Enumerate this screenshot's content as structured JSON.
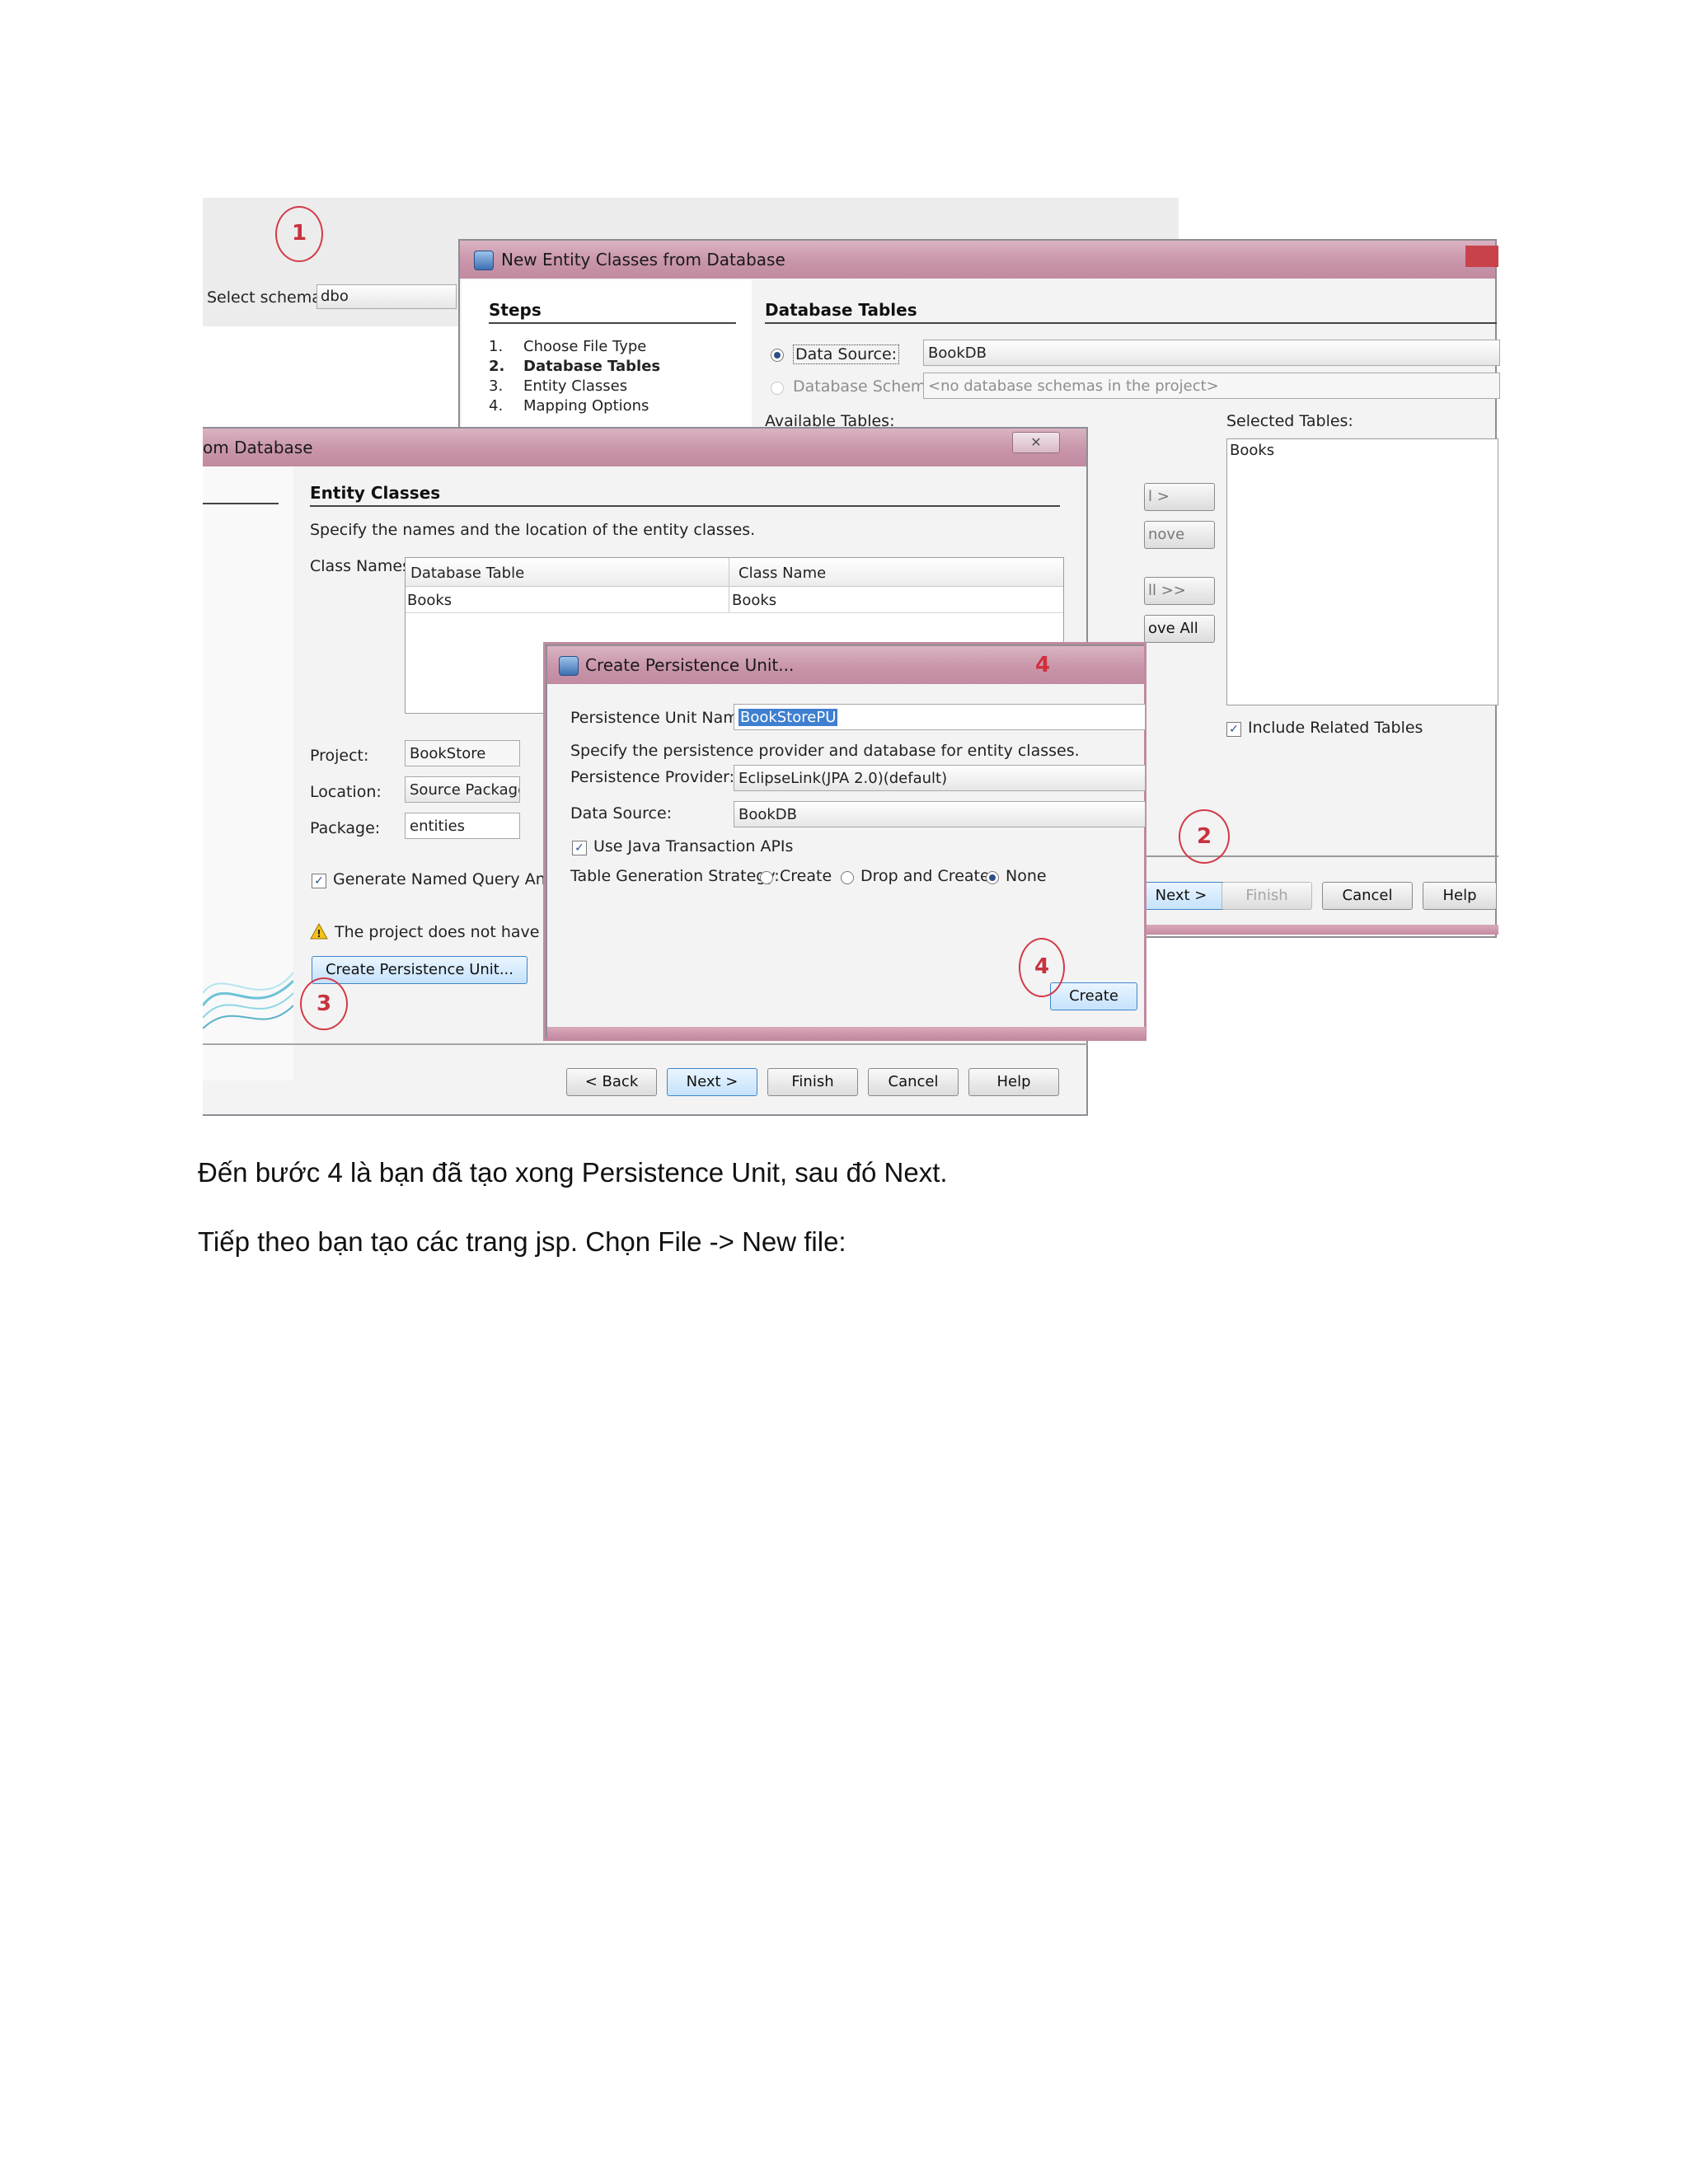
{
  "schema": {
    "label": "Select schema:",
    "value": "dbo"
  },
  "dialog1": {
    "title": "New Entity Classes from Database",
    "steps_heading": "Steps",
    "steps": [
      {
        "num": "1.",
        "label": "Choose File Type"
      },
      {
        "num": "2.",
        "label": "Database Tables"
      },
      {
        "num": "3.",
        "label": "Entity Classes"
      },
      {
        "num": "4.",
        "label": "Mapping Options"
      }
    ],
    "section": "Database Tables",
    "data_source_label": "Data Source:",
    "data_source_value": "BookDB",
    "schema_label": "Database Schema",
    "schema_value": "<no database schemas in the project>",
    "available_label": "Available Tables:",
    "selected_label": "Selected Tables:",
    "selected_items": [
      "Books"
    ],
    "partial_buttons": [
      "l >",
      "nove",
      "ll >>",
      "ove All"
    ],
    "include_related": "Include Related Tables",
    "buttons": {
      "next": "Next >",
      "finish": "Finish",
      "cancel": "Cancel",
      "help": "Help"
    }
  },
  "dialog2": {
    "title": "om Database",
    "close": "✕",
    "section": "Entity Classes",
    "description": "Specify the names and the location of the entity classes.",
    "class_names_label": "Class Names:",
    "columns": [
      "Database Table",
      "Class Name"
    ],
    "rows": [
      [
        "Books",
        "Books"
      ]
    ],
    "project_label": "Project:",
    "project_value": "BookStore",
    "location_label": "Location:",
    "location_value": "Source Packages",
    "package_label": "Package:",
    "package_value": "entities",
    "generate_label": "Generate Named Query Annota",
    "warning": "The project does not have a pe",
    "create_pu_button": "Create Persistence Unit...",
    "buttons": {
      "back": "< Back",
      "next": "Next >",
      "finish": "Finish",
      "cancel": "Cancel",
      "help": "Help"
    }
  },
  "dialog3": {
    "title": "Create Persistence Unit...",
    "title_marker": "4",
    "pu_name_label": "Persistence Unit Name:",
    "pu_name_value": "BookStorePU",
    "description": "Specify the persistence provider and database for entity classes.",
    "provider_label": "Persistence Provider:",
    "provider_value": "EclipseLink(JPA 2.0)(default)",
    "datasource_label": "Data Source:",
    "datasource_value": "BookDB",
    "jta_label": "Use Java Transaction APIs",
    "strategy_label": "Table Generation Strategy:",
    "strategy_options": [
      "Create",
      "Drop and Create",
      "None"
    ],
    "strategy_selected": "None",
    "create_button": "Create"
  },
  "markers": [
    "1",
    "2",
    "3",
    "4"
  ],
  "paragraphs": [
    "Đến bước 4 là bạn đã tạo xong Persistence Unit, sau đó Next.",
    "Tiếp theo bạn tạo các trang jsp. Chọn File -> New file:"
  ],
  "colors": {
    "titlebar": "#c995aa",
    "marker": "#d33a48",
    "selection": "#3f7fd0"
  }
}
